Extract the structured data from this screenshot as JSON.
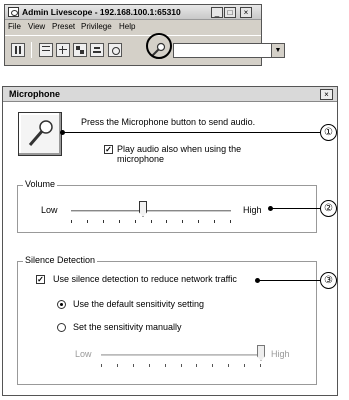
{
  "app": {
    "title": "Admin Livescope - 192.168.100.1:65310",
    "window_buttons": [
      "_",
      "□",
      "×"
    ],
    "menu": [
      "File",
      "View",
      "Preset",
      "Privilege",
      "Help"
    ],
    "toolbar_icons": [
      "pause-icon",
      "layout-icon",
      "zoom-icon",
      "snapshot-icon",
      "settings-icon",
      "record-icon",
      "microphone-icon"
    ],
    "camera_combo_value": ""
  },
  "dialog": {
    "title": "Microphone",
    "close": "×",
    "instruction": "Press the Microphone button to send audio.",
    "play_audio": {
      "label": "Play audio also when using the microphone",
      "checked": true
    },
    "volume": {
      "title": "Volume",
      "low": "Low",
      "high": "High",
      "level_fraction": 0.45
    },
    "silence": {
      "title": "Silence Detection",
      "use_detection": {
        "label": "Use silence detection to reduce network traffic",
        "checked": true
      },
      "default_radio": {
        "label": "Use the default sensitivity setting",
        "selected": true
      },
      "manual_radio": {
        "label": "Set the sensitivity manually",
        "selected": false
      },
      "sensitivity": {
        "low": "Low",
        "high": "High",
        "level_fraction": 1.0,
        "enabled": false
      }
    }
  },
  "callouts": [
    "①",
    "②",
    "③"
  ]
}
